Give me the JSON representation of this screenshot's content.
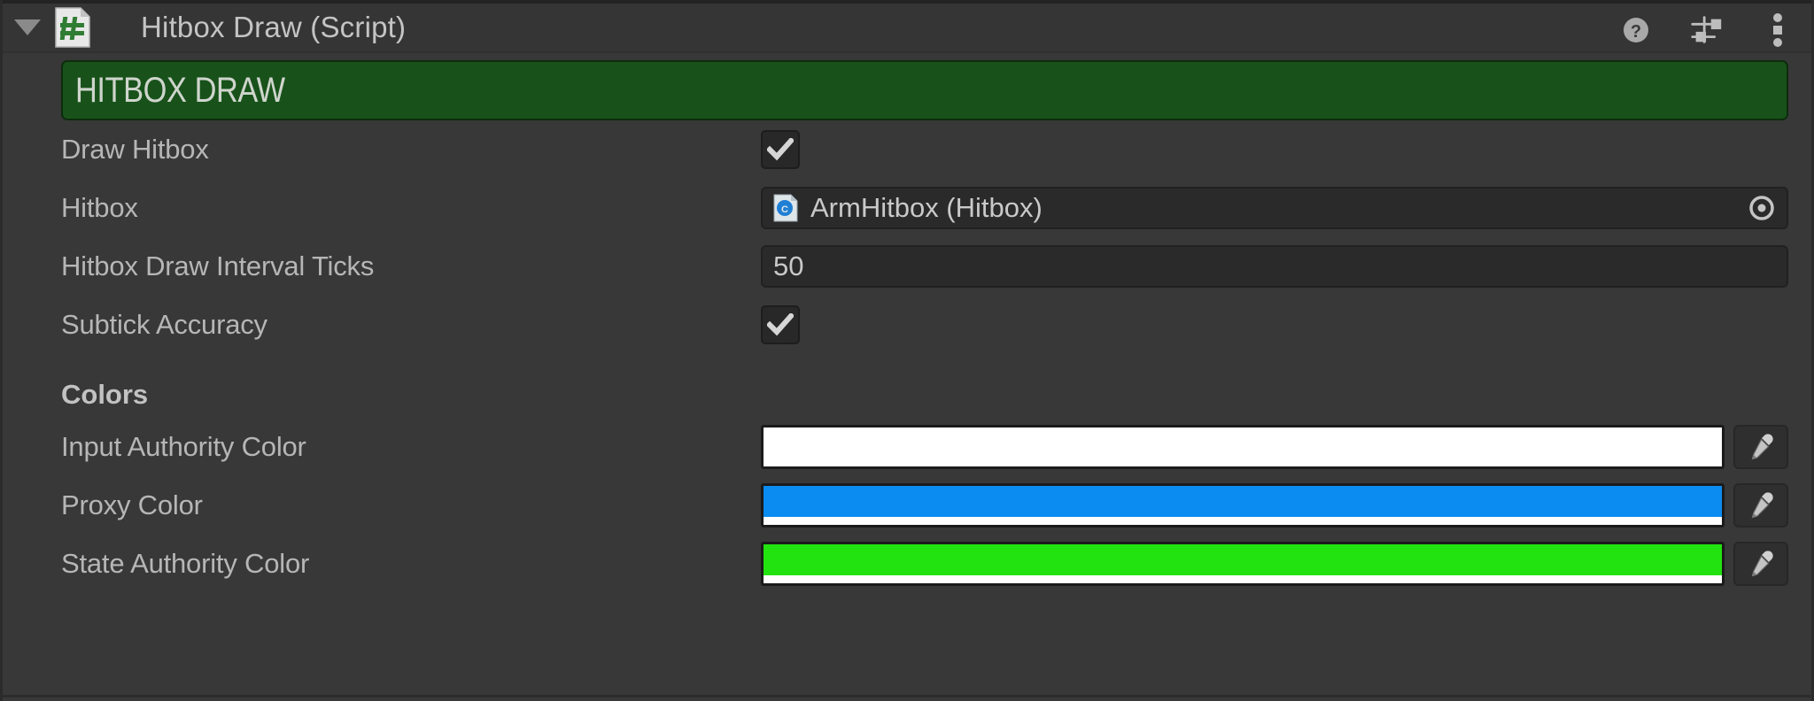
{
  "component": {
    "title": "Hitbox Draw (Script)",
    "foldout_icon": "triangle-down-icon",
    "script_icon": "csharp-script-icon",
    "header_icons": [
      {
        "name": "help-icon",
        "label": "?"
      },
      {
        "name": "preset-icon",
        "label": "Preset"
      },
      {
        "name": "kebab-menu-icon",
        "label": "More"
      }
    ]
  },
  "banner": {
    "text": "HITBOX DRAW",
    "background": "#18521a",
    "text_color": "#cfd5cd"
  },
  "properties": [
    {
      "label": "Draw Hitbox",
      "type": "checkbox",
      "value": true
    },
    {
      "label": "Hitbox",
      "type": "object",
      "value": "ArmHitbox (Hitbox)",
      "icon": "csharp-script-mini-icon"
    },
    {
      "label": "Hitbox Draw Interval Ticks",
      "type": "number",
      "value": "50"
    },
    {
      "label": "Subtick Accuracy",
      "type": "checkbox",
      "value": true
    }
  ],
  "colors_section": {
    "header": "Colors",
    "items": [
      {
        "label": "Input Authority Color",
        "color": "#ffffff",
        "alpha_color": "#ffffff"
      },
      {
        "label": "Proxy Color",
        "color": "#0b8cf0",
        "alpha_color": "#ffffff"
      },
      {
        "label": "State Authority Color",
        "color": "#22e310",
        "alpha_color": "#ffffff"
      }
    ],
    "eyedropper_icon": "eyedropper-icon"
  }
}
